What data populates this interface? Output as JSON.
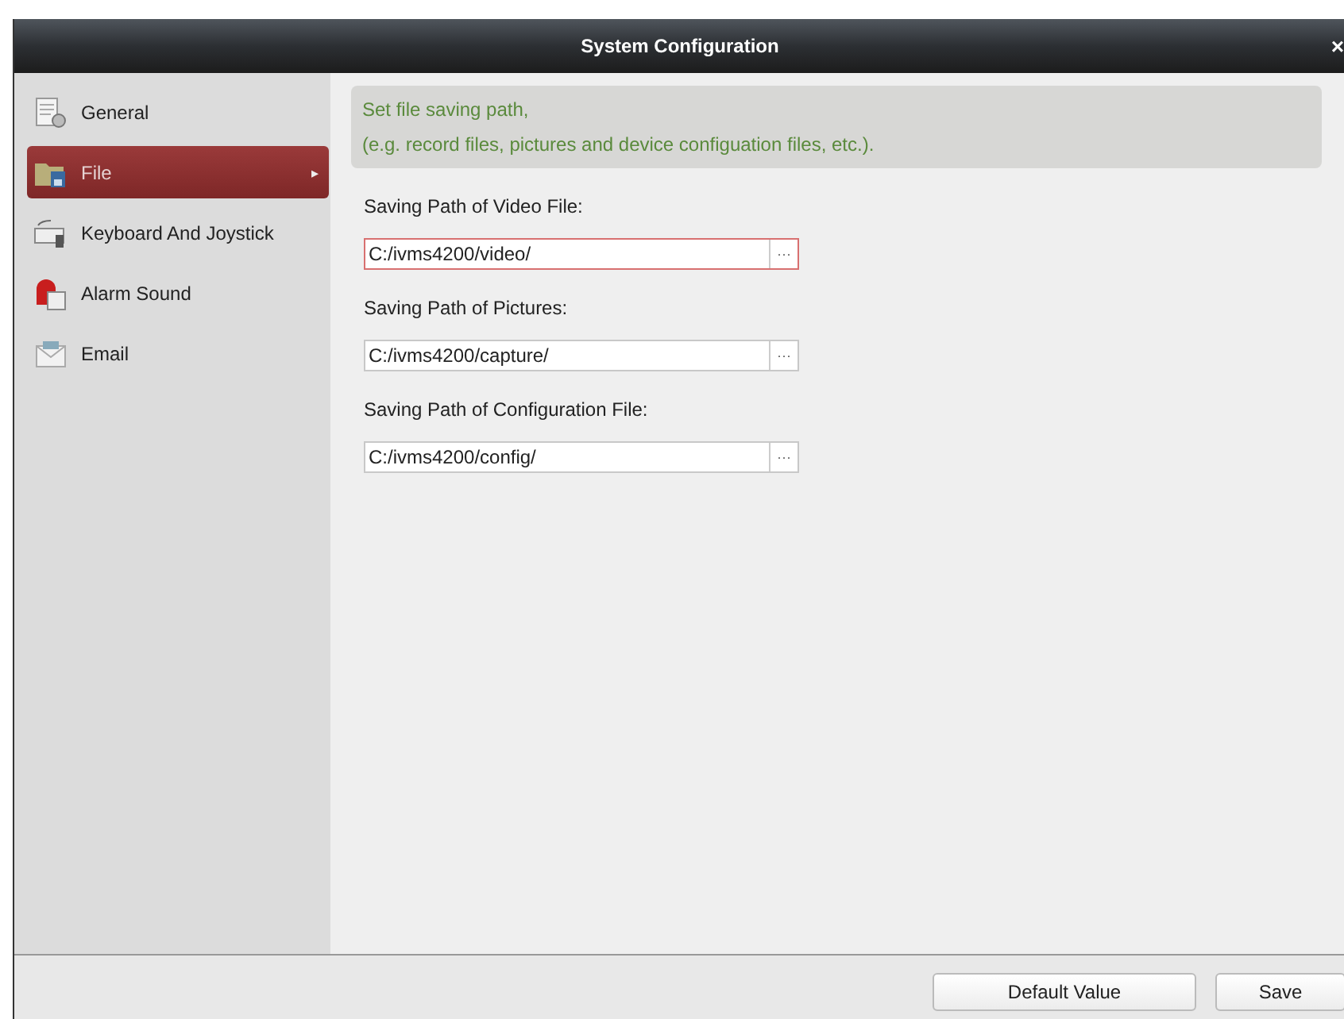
{
  "window": {
    "title": "System Configuration",
    "close": "×"
  },
  "sidebar": {
    "items": [
      {
        "label": "General",
        "kind": "general",
        "selected": false
      },
      {
        "label": "File",
        "kind": "file",
        "selected": true,
        "arrow": "▸"
      },
      {
        "label": "Keyboard And Joystick",
        "kind": "keyboard",
        "selected": false
      },
      {
        "label": "Alarm Sound",
        "kind": "alarm",
        "selected": false
      },
      {
        "label": "Email",
        "kind": "email",
        "selected": false
      }
    ]
  },
  "info": [
    "Set file saving path,",
    "(e.g. record files, pictures and device configuation files, etc.)."
  ],
  "fields": [
    {
      "label": "Saving Path of Video File:",
      "value": "C:/ivms4200/video/",
      "focused": true,
      "browse": "···"
    },
    {
      "label": "Saving Path of Pictures:",
      "value": "C:/ivms4200/capture/",
      "focused": false,
      "browse": "···"
    },
    {
      "label": "Saving Path of Configuration File:",
      "value": "C:/ivms4200/config/",
      "focused": false,
      "browse": "···"
    }
  ],
  "buttons": [
    "Default Value",
    "Save"
  ]
}
